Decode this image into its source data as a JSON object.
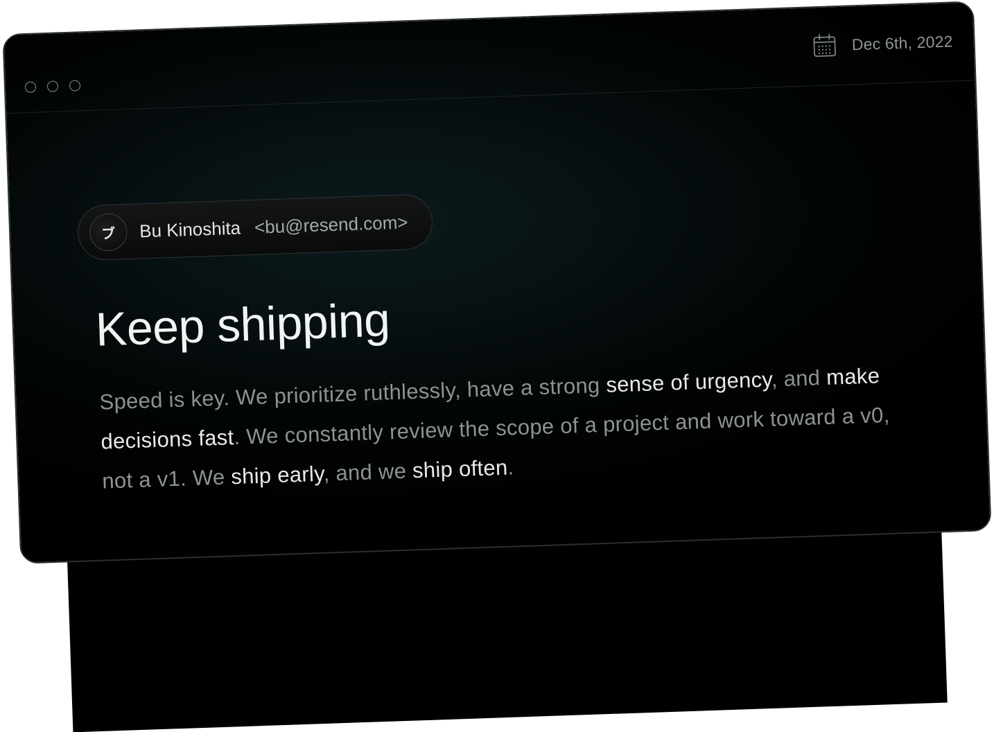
{
  "header": {
    "date": "Dec 6th, 2022",
    "icons": [
      "window-close-dot",
      "window-minimize-dot",
      "window-maximize-dot",
      "calendar-icon"
    ]
  },
  "sender": {
    "avatar_initial": "ブ",
    "name": "Bu Kinoshita",
    "email": "<bu@resend.com>"
  },
  "email": {
    "subject": "Keep shipping",
    "body": [
      {
        "text": "Speed is key. We prioritize ruthlessly, have a strong ",
        "highlight": false
      },
      {
        "text": "sense of urgency",
        "highlight": true
      },
      {
        "text": ", and ",
        "highlight": false
      },
      {
        "text": "make decisions fast",
        "highlight": true
      },
      {
        "text": ". We constantly review the scope of a project and work toward a v0, not a v1. We ",
        "highlight": false
      },
      {
        "text": "ship early",
        "highlight": true
      },
      {
        "text": ", and we ",
        "highlight": false
      },
      {
        "text": "ship often",
        "highlight": true
      },
      {
        "text": ".",
        "highlight": false
      }
    ]
  },
  "colors": {
    "background": "#000000",
    "text_muted": "#8d9293",
    "text_highlight": "#e9ebeb"
  }
}
